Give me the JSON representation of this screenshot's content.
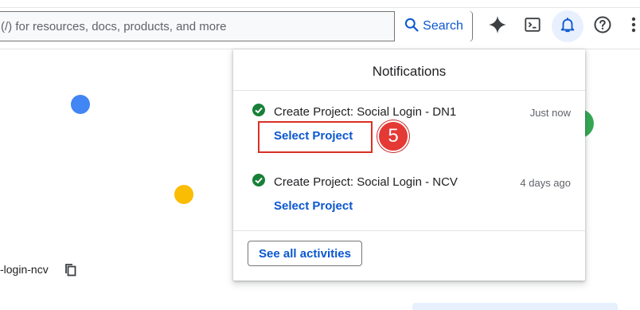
{
  "header": {
    "search_placeholder": "(/) for resources, docs, products, and more",
    "search_button_label": "Search",
    "icons": [
      "sparkle-icon",
      "terminal-icon",
      "bell-icon",
      "help-icon",
      "more-vert-icon"
    ]
  },
  "background": {
    "project_id_text": "-login-ncv",
    "dot_colors": {
      "blue": "#4285f4",
      "yellow": "#fbbc04",
      "green": "#34a853"
    }
  },
  "notifications": {
    "title": "Notifications",
    "items": [
      {
        "title": "Create Project: Social Login - DN1",
        "time": "Just now",
        "action": "Select Project"
      },
      {
        "title": "Create Project: Social Login - NCV",
        "time": "4 days ago",
        "action": "Select Project"
      }
    ],
    "see_all_label": "See all activities"
  },
  "annotation": {
    "step_number": "5",
    "color": "#e53935"
  }
}
